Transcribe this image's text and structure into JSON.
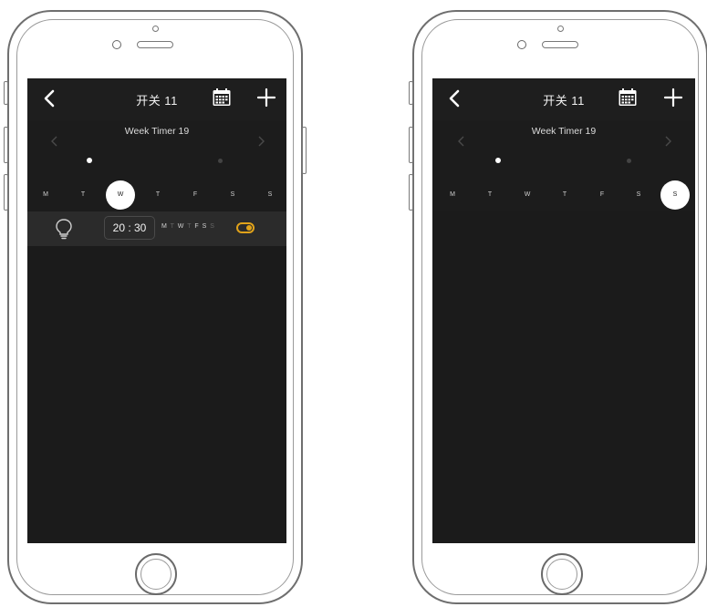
{
  "phones": [
    {
      "title": "开关 11",
      "week_title": "Week Timer 19",
      "days": [
        "M",
        "T",
        "W",
        "T",
        "F",
        "S",
        "S"
      ],
      "selected_day_index": 2,
      "timer": {
        "time": "20 : 30",
        "days_mini": [
          {
            "label": "M",
            "active": true
          },
          {
            "label": "T",
            "active": false
          },
          {
            "label": "W",
            "active": true
          },
          {
            "label": "T",
            "active": false
          },
          {
            "label": "F",
            "active": true
          },
          {
            "label": "S",
            "active": true
          },
          {
            "label": "S",
            "active": false
          }
        ],
        "enabled": true
      }
    },
    {
      "title": "开关 11",
      "week_title": "Week Timer 19",
      "days": [
        "M",
        "T",
        "W",
        "T",
        "F",
        "S",
        "S"
      ],
      "selected_day_index": 6
    }
  ],
  "icons": {
    "back": "chevron-left-icon",
    "calendar": "calendar-icon",
    "add": "plus-icon",
    "bulb": "lightbulb-icon",
    "toggle": "toggle-icon"
  },
  "colors": {
    "screen_bg": "#1b1b1b",
    "timer_row_bg": "#2b2b2b",
    "accent": "#e0a21a"
  }
}
